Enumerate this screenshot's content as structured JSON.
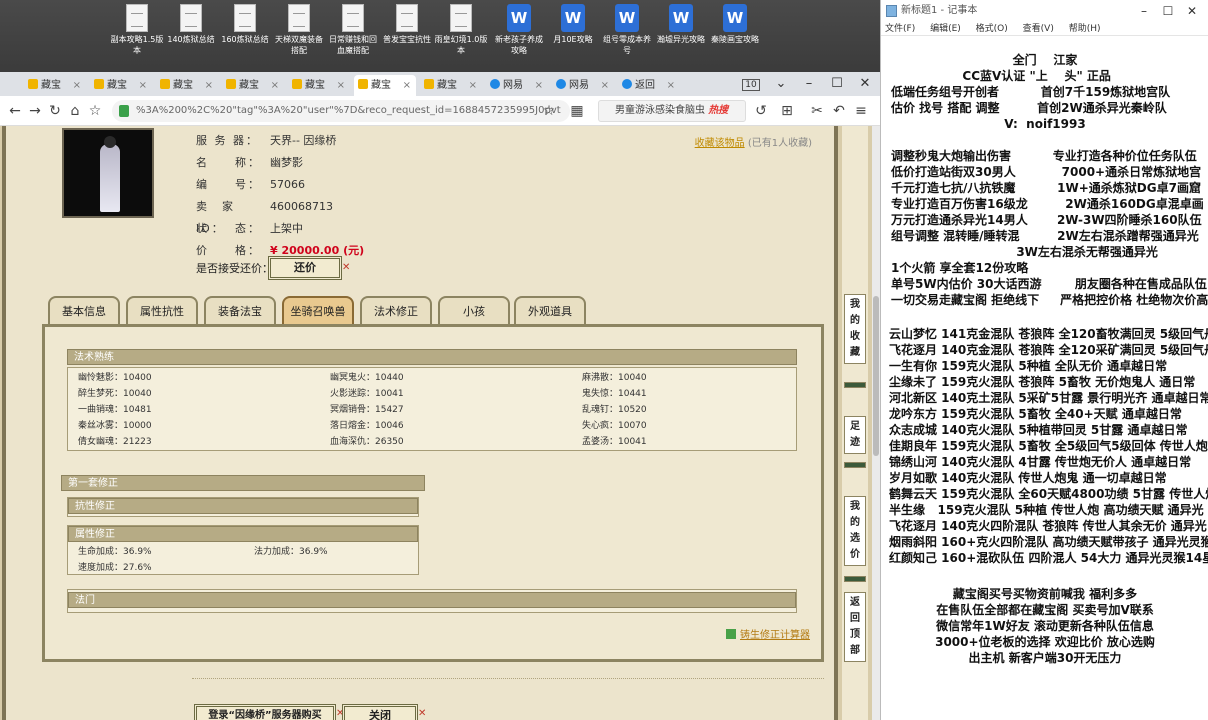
{
  "desktop": {
    "icons": [
      {
        "label": "副本攻略1.5版本",
        "kind": "doc"
      },
      {
        "label": "140炼狱总结",
        "kind": "doc"
      },
      {
        "label": "160炼狱总结",
        "kind": "doc"
      },
      {
        "label": "天梯双魔装备搭配",
        "kind": "doc"
      },
      {
        "label": "日常赚钱和回血魔搭配",
        "kind": "doc"
      },
      {
        "label": "普发宝宝抗性",
        "kind": "doc"
      },
      {
        "label": "雨皇幻境1.0版本",
        "kind": "doc"
      },
      {
        "label": "新老孩子养成攻略",
        "kind": "wps"
      },
      {
        "label": "月10E攻略",
        "kind": "wps"
      },
      {
        "label": "组号零成本养号",
        "kind": "wps"
      },
      {
        "label": "瀚墟异光攻略",
        "kind": "wps"
      },
      {
        "label": "秦陵画宝攻略",
        "kind": "wps"
      }
    ]
  },
  "browser": {
    "tabs": [
      {
        "label": "藏宝",
        "active": false
      },
      {
        "label": "藏宝",
        "active": false
      },
      {
        "label": "藏宝",
        "active": false
      },
      {
        "label": "藏宝",
        "active": false
      },
      {
        "label": "藏宝",
        "active": false
      },
      {
        "label": "藏宝",
        "active": true
      },
      {
        "label": "藏宝",
        "active": false
      },
      {
        "label": "网易",
        "active": false
      },
      {
        "label": "网易",
        "active": false
      },
      {
        "label": "返回",
        "active": false
      }
    ],
    "tab_count": "10",
    "url": "%3A%200%2C%20\"tag\"%3A%20\"user\"%7D&reco_request_id=1688457235995J0pvt",
    "search_text": "男童游泳感染食脑虫",
    "search_badge": "热搜"
  },
  "product": {
    "server_key": "服 务 器：",
    "server_val": "天界-- 因缘桥",
    "name_key": "名　　称：",
    "name_val": "幽梦影",
    "id_key": "编　　号：",
    "id_val": "57066",
    "seller_key": "卖　家　ID：",
    "seller_val": "460068713",
    "status_key": "状　　态：",
    "status_val": "上架中",
    "price_key": "价　　格：",
    "price_val": "¥ 20000.00 (元)",
    "offer_label": "是否接受还价：",
    "offer_button": "还价",
    "collect_link": "收藏该物品",
    "collect_count": "(已有1人收藏)"
  },
  "tabs": [
    "基本信息",
    "属性抗性",
    "装备法宝",
    "坐骑召唤兽",
    "法术修正",
    "小孩",
    "外观道具"
  ],
  "active_tab": 3,
  "spell_section": {
    "title": "法术熟练",
    "skills": [
      [
        "幽怜魅影：10400",
        "幽冥鬼火：10440",
        "麻沸散：10040"
      ],
      [
        "醉生梦死：10040",
        "火影迷踪：10041",
        "鬼失惊：10441"
      ],
      [
        "一曲销魂：10481",
        "冥烟销骨：15427",
        "乱魂钉：10520"
      ],
      [
        "秦丝冰雾：10000",
        "落日熔金：10046",
        "失心疯：10070"
      ],
      [
        "倩女幽魂：21223",
        "血海深仇：26350",
        "孟婆汤：10041"
      ]
    ]
  },
  "correction": {
    "title": "第一套修正",
    "resist_title": "抗性修正",
    "attr_title": "属性修正",
    "attrs": [
      "生命加成：36.9%",
      "法力加成：36.9%",
      "速度加成：27.6%"
    ],
    "spell_title": "法门"
  },
  "calc_link": "铸生修正计算器",
  "side_buttons": [
    "我的收藏",
    "足迹",
    "我的选价",
    "返回顶部"
  ],
  "bottom_buttons": [
    "登录“因缘桥”服务器购买",
    "关闭"
  ],
  "notepad": {
    "title": "新标题1 - 记事本",
    "menu": [
      "文件(F)",
      "编辑(E)",
      "格式(O)",
      "查看(V)",
      "帮助(H)"
    ],
    "lines": [
      "全门    江家",
      "CC蓝V认证 \"上    头\" 正品    ",
      "低端任务组号开创者          首创7千159炼狱地宫队",
      "估价 找号 搭配 调整         首创2W通杀异光秦岭队",
      "V:  noif1993",
      "",
      "调整秒鬼大炮输出伤害          专业打造各种价位任务队伍",
      "低价打造站街双30男人           7000+通杀日常炼狱地宫",
      "千元打造七抗/八抗铁魔          1W+通杀炼狱DG卓7画窟",
      "专业打造百万伤害16级龙         2W通杀160DG卓混卓画",
      "万元打造通杀异光14男人       2W-3W四阶睡杀160队伍",
      "组号调整 混转睡/睡转混         2W左右混杀蹭帮强通异光",
      "                              3W左右混杀无帮强通异光",
      "1个火箭 享全套12份攻略",
      "单号5W内估价 30大话西游        朋友圈各种在售成品队伍",
      "一切交易走藏宝阁 拒绝线下     严格把控价格 杜绝物次价高",
      "",
      "云山梦忆 141克金混队 苍狼阵 全120畜牧满回灵 5级回气丹",
      "飞花逐月 140克金混队 苍狼阵 全120采矿满回灵 5级回气丹",
      "一生有你 159克火混队 5种植 全队无价 通卓越日常",
      "尘缘未了 159克火混队 苍狼阵 5畜牧 无价炮鬼人 通日常",
      "河北新区 140克土混队 5采矿5甘露 景行明光齐 通卓越日常",
      "龙吟东方 159克火混队 5畜牧 全40+天赋 通卓越日常",
      "众志成城 140克火混队 5种植带回灵 5甘露 通卓越日常",
      "佳期良年 159克火混队 5畜牧 全5级回气5级回体 传世人炮",
      "锦绣山河 140克火混队 4甘露 传世炮无价人 通卓越日常",
      "岁月如歌 140克火混队 传世人炮鬼 通一切卓越日常",
      "鹤舞云天 159克火混队 全60天赋4800功绩 5甘露 传世人炮",
      "半生缘   159克火混队 5种植 传世人炮 高功绩天赋 通异光",
      "飞花逐月 140克火四阶混队 苍狼阵 传世人其余无价 通异光",
      "烟雨斜阳 160+克火四阶混队 高功绩天赋带孩子 通异光灵猴",
      "红颜知己 160+混砍队伍 四阶混人 54大力 通异光灵猴14星",
      "",
      "藏宝阁买号买物资前喊我 福利多多",
      "在售队伍全部都在藏宝阁 买卖号加V联系",
      "微信常年1W好友 滚动更新各种队伍信息",
      "3000+位老板的选择 欢迎比价 放心选购",
      "出主机 新客户端30开无压力"
    ]
  }
}
